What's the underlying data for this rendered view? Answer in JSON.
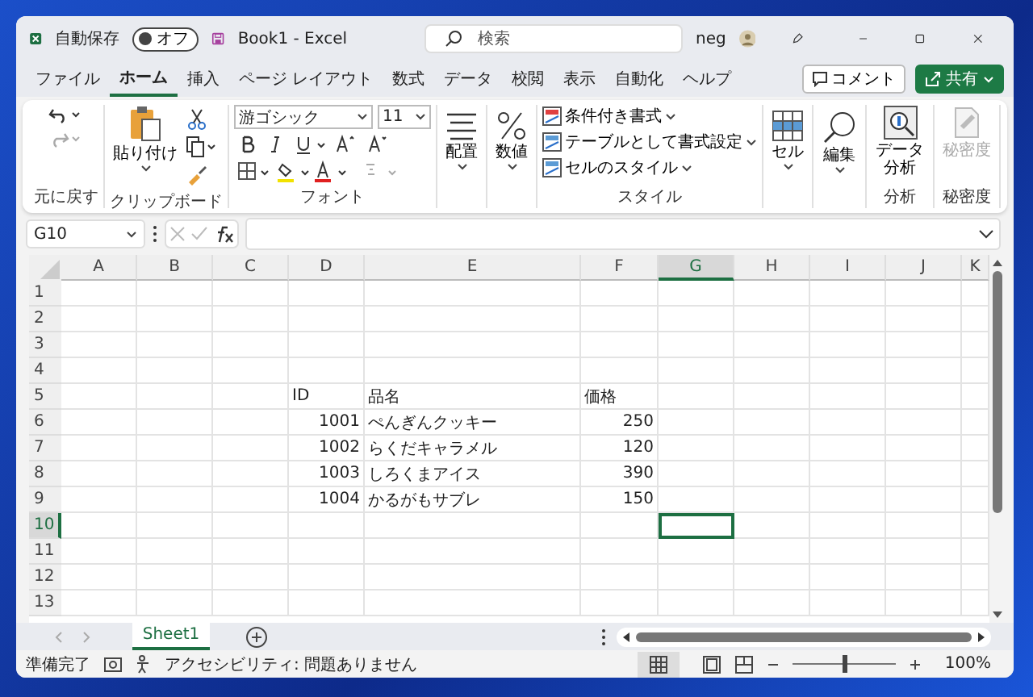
{
  "title_bar": {
    "autosave_label": "自動保存",
    "autosave": {
      "label": "オフ",
      "on": false
    },
    "file_title": "Book1  -  Excel",
    "search": {
      "placeholder": "検索"
    },
    "user": "neg"
  },
  "menu_tabs": [
    {
      "label": "ファイル",
      "selected": false
    },
    {
      "label": "ホーム",
      "selected": true
    },
    {
      "label": "挿入",
      "selected": false
    },
    {
      "label": "ページ レイアウト",
      "selected": false
    },
    {
      "label": "数式",
      "selected": false
    },
    {
      "label": "データ",
      "selected": false
    },
    {
      "label": "校閲",
      "selected": false
    },
    {
      "label": "表示",
      "selected": false
    },
    {
      "label": "自動化",
      "selected": false
    },
    {
      "label": "ヘルプ",
      "selected": false
    }
  ],
  "comment_button": "コメント",
  "share_button": "共有",
  "ribbon": {
    "undo_group": "元に戻す",
    "paste": "貼り付け",
    "clipboard_group": "クリップボード",
    "font_name": "游ゴシック",
    "font_size": "11",
    "font_group": "フォント",
    "alignment": "配置",
    "number": "数値",
    "styles": [
      "条件付き書式",
      "テーブルとして書式設定",
      "セルのスタイル"
    ],
    "style_group": "スタイル",
    "cells": "セル",
    "editing": "編集",
    "analyze_data": "データ分析",
    "analysis_group": "分析",
    "sensitivity": {
      "label": "秘密度",
      "disabled": true
    },
    "sensitivity_group": "秘密度"
  },
  "formula_bar": {
    "name_box": "G10"
  },
  "columns": [
    {
      "label": "A",
      "selected": false
    },
    {
      "label": "B",
      "selected": false
    },
    {
      "label": "C",
      "selected": false
    },
    {
      "label": "D",
      "selected": false
    },
    {
      "label": "E",
      "selected": false
    },
    {
      "label": "F",
      "selected": false
    },
    {
      "label": "G",
      "selected": true
    },
    {
      "label": "H",
      "selected": false
    },
    {
      "label": "I",
      "selected": false
    },
    {
      "label": "J",
      "selected": false
    },
    {
      "label": "K",
      "selected": false
    }
  ],
  "rows": [
    {
      "number": "1",
      "selected": false
    },
    {
      "number": "2",
      "selected": false
    },
    {
      "number": "3",
      "selected": false
    },
    {
      "number": "4",
      "selected": false
    },
    {
      "number": "5",
      "selected": false,
      "cells": [
        {
          "kind": "text",
          "text": "ID"
        },
        {
          "kind": "text",
          "text": "品名"
        },
        {
          "kind": "text",
          "text": "価格"
        }
      ]
    },
    {
      "number": "6",
      "selected": false,
      "cells": [
        {
          "kind": "number",
          "text": "1001"
        },
        {
          "kind": "text",
          "text": "ぺんぎんクッキー"
        },
        {
          "kind": "number",
          "text": "250"
        }
      ]
    },
    {
      "number": "7",
      "selected": false,
      "cells": [
        {
          "kind": "number",
          "text": "1002"
        },
        {
          "kind": "text",
          "text": "らくだキャラメル"
        },
        {
          "kind": "number",
          "text": "120"
        }
      ]
    },
    {
      "number": "8",
      "selected": false,
      "cells": [
        {
          "kind": "number",
          "text": "1003"
        },
        {
          "kind": "text",
          "text": "しろくまアイス"
        },
        {
          "kind": "number",
          "text": "390"
        }
      ]
    },
    {
      "number": "9",
      "selected": false,
      "cells": [
        {
          "kind": "number",
          "text": "1004"
        },
        {
          "kind": "text",
          "text": "かるがもサブレ"
        },
        {
          "kind": "number",
          "text": "150"
        }
      ]
    },
    {
      "number": "10",
      "selected": true
    },
    {
      "number": "11",
      "selected": false
    },
    {
      "number": "12",
      "selected": false
    },
    {
      "number": "13",
      "selected": false
    }
  ],
  "sheet_tabs": [
    {
      "label": "Sheet1",
      "selected": true
    }
  ],
  "status_bar": {
    "ready": "準備完了",
    "accessibility": "アクセシビリティ: 問題ありません",
    "zoom": {
      "level": 0.5
    },
    "zoom_label": "100%"
  }
}
